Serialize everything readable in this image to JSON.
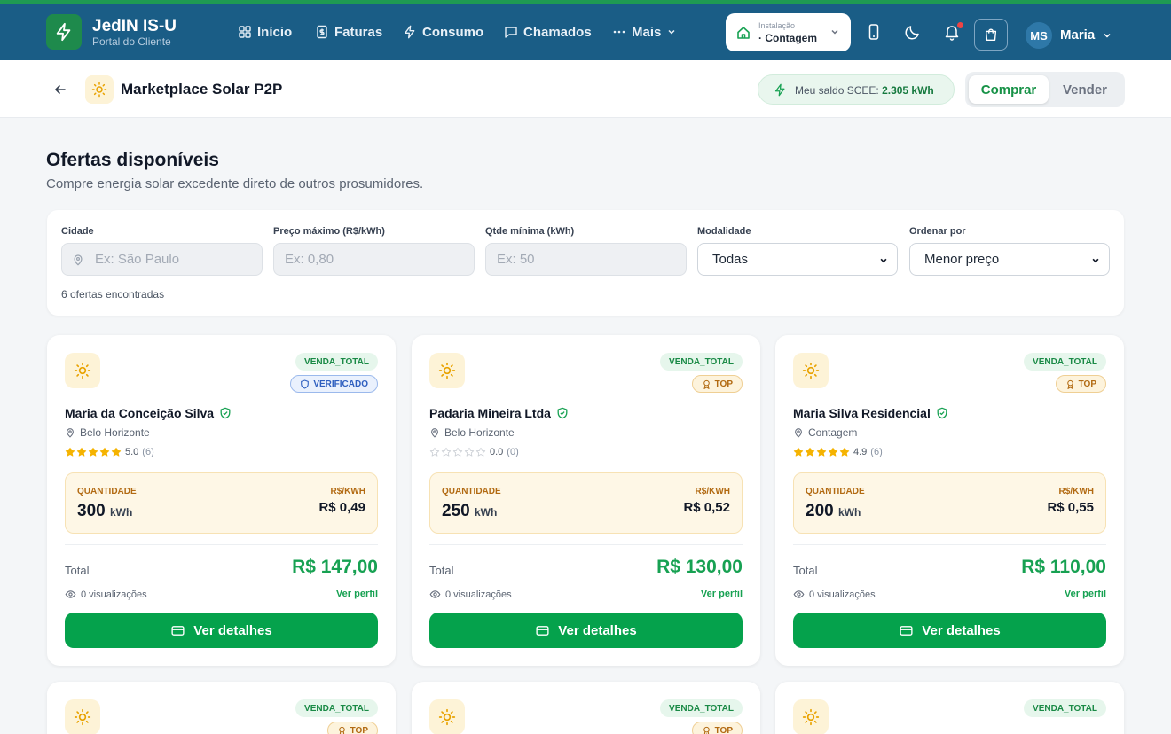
{
  "brand": {
    "title": "JedIN IS-U",
    "subtitle": "Portal do Cliente"
  },
  "nav": [
    {
      "label": "Início",
      "icon": "grid-icon"
    },
    {
      "label": "Faturas",
      "icon": "invoice-icon"
    },
    {
      "label": "Consumo",
      "icon": "bolt-icon"
    },
    {
      "label": "Chamados",
      "icon": "chat-icon"
    },
    {
      "label": "Mais",
      "icon": "dots-icon"
    }
  ],
  "installation": {
    "label": "Instalação",
    "value": "· Contagem"
  },
  "user": {
    "initials": "MS",
    "name": "Maria"
  },
  "page": {
    "title": "Marketplace Solar P2P",
    "balance_label": "Meu saldo SCEE:",
    "balance_value": "2.305 kWh",
    "toggle": {
      "buy": "Comprar",
      "sell": "Vender",
      "active": "buy"
    }
  },
  "heading": {
    "title": "Ofertas disponíveis",
    "subtitle": "Compre energia solar excedente direto de outros prosumidores."
  },
  "filters": {
    "city": {
      "label": "Cidade",
      "placeholder": "Ex: São Paulo",
      "value": ""
    },
    "max_price": {
      "label": "Preço máximo (R$/kWh)",
      "placeholder": "Ex: 0,80",
      "value": ""
    },
    "min_qty": {
      "label": "Qtde mínima (kWh)",
      "placeholder": "Ex: 50",
      "value": ""
    },
    "modality": {
      "label": "Modalidade",
      "value": "Todas"
    },
    "sort": {
      "label": "Ordenar por",
      "value": "Menor preço"
    },
    "result_count": "6 ofertas encontradas"
  },
  "card_labels": {
    "quantity": "QUANTIDADE",
    "price": "R$/KWH",
    "unit": "kWh",
    "total": "Total",
    "profile": "Ver perfil",
    "details": "Ver detalhes"
  },
  "offers": [
    {
      "modality": "VENDA_TOTAL",
      "badge": "VERIFICADO",
      "badge_type": "verified",
      "seller": "Maria da Conceição Silva",
      "city": "Belo Horizonte",
      "rating": 5.0,
      "rating_text": "5.0",
      "reviews": "(6)",
      "quantity": "300",
      "price": "R$ 0,49",
      "total": "R$ 147,00",
      "views": "0 visualizações"
    },
    {
      "modality": "VENDA_TOTAL",
      "badge": "TOP",
      "badge_type": "top",
      "seller": "Padaria Mineira Ltda",
      "city": "Belo Horizonte",
      "rating": 0.0,
      "rating_text": "0.0",
      "reviews": "(0)",
      "quantity": "250",
      "price": "R$ 0,52",
      "total": "R$ 130,00",
      "views": "0 visualizações"
    },
    {
      "modality": "VENDA_TOTAL",
      "badge": "TOP",
      "badge_type": "top",
      "seller": "Maria Silva Residencial",
      "city": "Contagem",
      "rating": 4.9,
      "rating_text": "4.9",
      "reviews": "(6)",
      "quantity": "200",
      "price": "R$ 0,55",
      "total": "R$ 110,00",
      "views": "0 visualizações"
    },
    {
      "modality": "VENDA_TOTAL",
      "badge": "TOP",
      "badge_type": "top"
    },
    {
      "modality": "VENDA_TOTAL",
      "badge": "TOP",
      "badge_type": "top"
    },
    {
      "modality": "VENDA_TOTAL"
    }
  ],
  "colors": {
    "header": "#1a5d86",
    "primary_green": "#05a24c",
    "price_green": "#17a152",
    "star": "#f5b301",
    "accent_amber": "#b26a12"
  }
}
